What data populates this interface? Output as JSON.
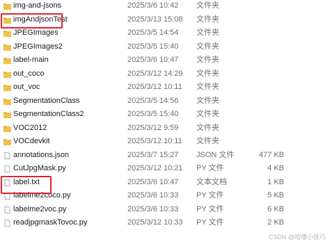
{
  "files": [
    {
      "name": "img-and-jsons",
      "date": "2025/3/6 10:42",
      "type": "文件夹",
      "size": "",
      "icon": "folder-icon"
    },
    {
      "name": "imgAndjsonTest",
      "date": "2025/3/13 15:08",
      "type": "文件夹",
      "size": "",
      "icon": "folder-icon"
    },
    {
      "name": "JPEGImages",
      "date": "2025/3/5 14:54",
      "type": "文件夹",
      "size": "",
      "icon": "folder-icon"
    },
    {
      "name": "JPEGImages2",
      "date": "2025/3/5 15:40",
      "type": "文件夹",
      "size": "",
      "icon": "folder-icon"
    },
    {
      "name": "label-main",
      "date": "2025/3/6 10:47",
      "type": "文件夹",
      "size": "",
      "icon": "folder-icon"
    },
    {
      "name": "out_coco",
      "date": "2025/3/12 14:29",
      "type": "文件夹",
      "size": "",
      "icon": "folder-icon"
    },
    {
      "name": "out_voc",
      "date": "2025/3/12 10:11",
      "type": "文件夹",
      "size": "",
      "icon": "folder-icon"
    },
    {
      "name": "SegmentationClass",
      "date": "2025/3/5 14:56",
      "type": "文件夹",
      "size": "",
      "icon": "folder-icon"
    },
    {
      "name": "SegmentationClass2",
      "date": "2025/3/5 15:40",
      "type": "文件夹",
      "size": "",
      "icon": "folder-icon"
    },
    {
      "name": "VOC2012",
      "date": "2025/3/12 9:59",
      "type": "文件夹",
      "size": "",
      "icon": "folder-icon"
    },
    {
      "name": "VOCdevkit",
      "date": "2025/3/12 10:11",
      "type": "文件夹",
      "size": "",
      "icon": "folder-icon"
    },
    {
      "name": "annotations.json",
      "date": "2025/3/7 15:27",
      "type": "JSON 文件",
      "size": "477 KB",
      "icon": "file-icon"
    },
    {
      "name": "CutJpgMask.py",
      "date": "2025/3/12 10:21",
      "type": "PY 文件",
      "size": "4 KB",
      "icon": "file-icon"
    },
    {
      "name": "label.txt",
      "date": "2025/3/6 10:47",
      "type": "文本文档",
      "size": "1 KB",
      "icon": "file-icon"
    },
    {
      "name": "labelme2coco.py",
      "date": "2025/3/6 10:33",
      "type": "PY 文件",
      "size": "5 KB",
      "icon": "file-icon"
    },
    {
      "name": "labelme2voc.py",
      "date": "2025/3/6 10:33",
      "type": "PY 文件",
      "size": "6 KB",
      "icon": "file-icon"
    },
    {
      "name": "readjpgmaskTovoc.py",
      "date": "2025/3/12 10:33",
      "type": "PY 文件",
      "size": "2 KB",
      "icon": "file-icon"
    }
  ],
  "highlighted_items": [
    "imgAndjsonTest",
    "label.txt"
  ],
  "watermark": "CSDN @哈喽小技巧",
  "colors": {
    "folder": "#f0c24b",
    "folder_tab": "#e0a92e",
    "highlight": "#e0242b",
    "secondary_text": "#6d6d6d"
  }
}
